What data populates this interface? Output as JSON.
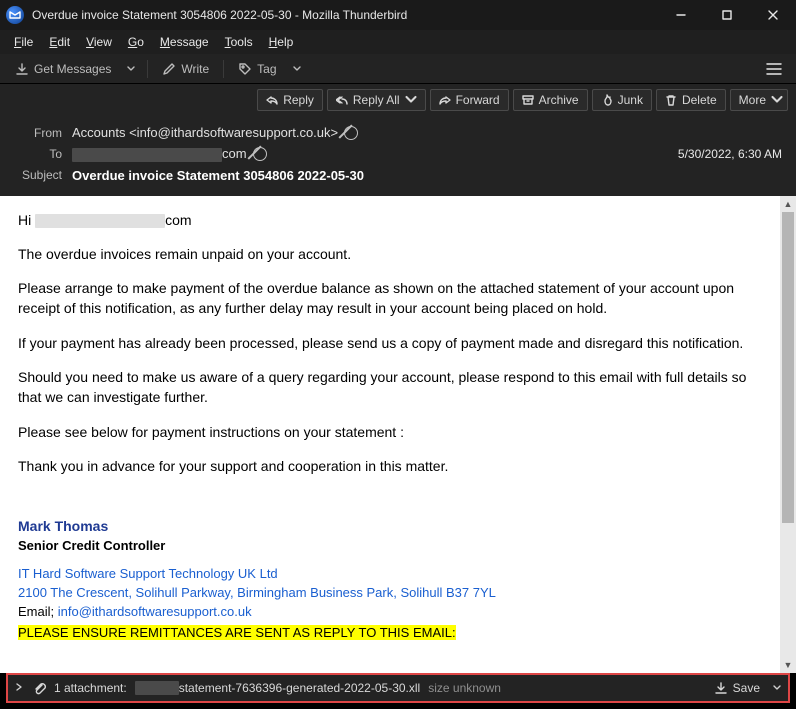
{
  "window": {
    "title": "Overdue invoice Statement 3054806 2022-05-30 - Mozilla Thunderbird"
  },
  "menu": {
    "file": "File",
    "edit": "Edit",
    "view": "View",
    "go": "Go",
    "message": "Message",
    "tools": "Tools",
    "help": "Help"
  },
  "toolbar": {
    "get_messages": "Get Messages",
    "write": "Write",
    "tag": "Tag"
  },
  "actions": {
    "reply": "Reply",
    "reply_all": "Reply All",
    "forward": "Forward",
    "archive": "Archive",
    "junk": "Junk",
    "delete": "Delete",
    "more": "More"
  },
  "headers": {
    "from_label": "From",
    "from_value": "Accounts <info@ithardsoftwaresupport.co.uk>",
    "to_label": "To",
    "to_suffix": "com",
    "datetime": "5/30/2022, 6:30 AM",
    "subject_label": "Subject",
    "subject_value": "Overdue invoice Statement 3054806 2022-05-30"
  },
  "body": {
    "greeting_prefix": "Hi ",
    "greeting_suffix": "com",
    "p1": "The overdue invoices remain unpaid on your account.",
    "p2": "Please arrange to make payment of the overdue balance as shown on the attached statement of your account upon receipt of this notification, as any further delay may result in your account being placed on hold.",
    "p3": "If your payment has already been processed, please send us a copy of payment made and disregard this notification.",
    "p4": "Should you need to make us aware of a query regarding your account, please respond to this email with full details so that we can investigate further.",
    "p5": "Please see below for payment instructions on your statement :",
    "p6": "Thank you in advance for your support and cooperation in this matter.",
    "sig_name": "Mark Thomas",
    "sig_title": "Senior Credit Controller",
    "sig_company": "IT Hard Software Support Technology UK Ltd",
    "sig_address": "2100 The Crescent, Solihull Parkway, Birmingham Business Park, Solihull B37 7YL",
    "sig_email_label": "Email;  ",
    "sig_email": "info@ithardsoftwaresupport.co.uk",
    "highlight": "PLEASE ENSURE REMITTANCES ARE SENT AS REPLY TO THIS EMAIL:"
  },
  "attachment": {
    "count_label": "1 attachment:",
    "name_suffix": "statement-7636396-generated-2022-05-30.xll",
    "size": "size unknown",
    "save": "Save"
  }
}
